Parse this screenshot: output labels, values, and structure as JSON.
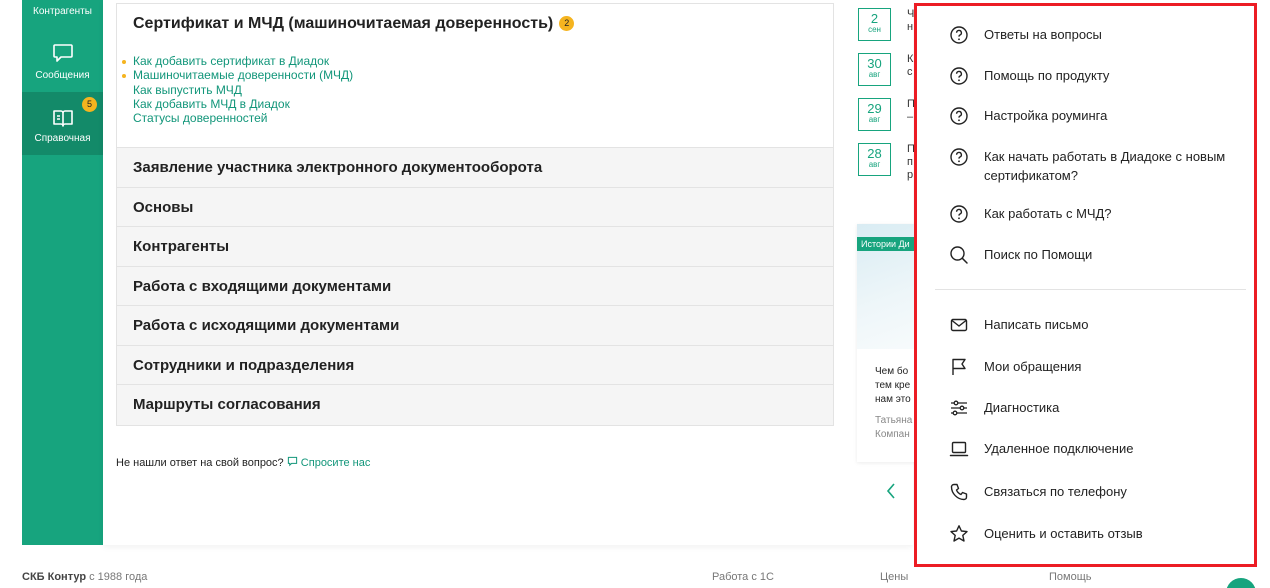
{
  "sidebar": {
    "items": [
      {
        "label": "Контрагенты",
        "icon": "contractors-icon"
      },
      {
        "label": "Сообщения",
        "icon": "chat-bubble-icon"
      },
      {
        "label": "Справочная",
        "icon": "book-icon",
        "badge": "5"
      }
    ]
  },
  "main": {
    "open_section": {
      "title": "Сертификат и МЧД (машиночитаемая доверенность)",
      "badge": "2",
      "links": [
        "Как добавить сертификат в Диадок",
        "Машиночитаемые доверенности (МЧД)",
        "Как выпустить МЧД",
        "Как добавить МЧД в Диадок",
        "Статусы доверенностей"
      ]
    },
    "sections": [
      "Заявление участника электронного документооборота",
      "Основы",
      "Контрагенты",
      "Работа с входящими документами",
      "Работа с исходящими документами",
      "Сотрудники и подразделения",
      "Маршруты согласования"
    ],
    "not_found_text": "Не нашли ответ на свой вопрос?",
    "ask_link": "Спросите нас"
  },
  "news": {
    "items": [
      {
        "day": "2",
        "month": "сен",
        "text": "Ч н"
      },
      {
        "day": "30",
        "month": "авг",
        "text": "К с"
      },
      {
        "day": "29",
        "month": "авг",
        "text": "П –"
      },
      {
        "day": "28",
        "month": "авг",
        "text": "П п р"
      }
    ],
    "story": {
      "tag": "Истории Ди",
      "title_lines": [
        "Чем бо",
        "тем кре",
        "нам это"
      ],
      "author_lines": [
        "Татьяна",
        "Компан"
      ]
    }
  },
  "help_menu": {
    "items": [
      {
        "label": "Ответы на вопросы",
        "icon": "question-circle-icon"
      },
      {
        "label": "Помощь по продукту",
        "icon": "question-circle-icon"
      },
      {
        "label": "Настройка роуминга",
        "icon": "question-circle-icon"
      },
      {
        "label": "Как начать работать в Диадоке с новым сертификатом?",
        "icon": "question-circle-icon"
      },
      {
        "label": "Как работать с МЧД?",
        "icon": "question-circle-icon"
      },
      {
        "label": "Поиск по Помощи",
        "icon": "search-icon"
      },
      {
        "label": "Написать письмо",
        "icon": "envelope-icon"
      },
      {
        "label": "Мои обращения",
        "icon": "flag-icon"
      },
      {
        "label": "Диагностика",
        "icon": "sliders-icon"
      },
      {
        "label": "Удаленное подключение",
        "icon": "laptop-icon"
      },
      {
        "label": "Связаться по телефону",
        "icon": "phone-icon"
      },
      {
        "label": "Оценить и оставить отзыв",
        "icon": "star-icon"
      }
    ]
  },
  "footer": {
    "brand": "СКБ Контур",
    "since": " с 1988 года",
    "links": [
      "Работа с 1С",
      "Цены",
      "Помощь"
    ]
  },
  "colors": {
    "accent": "#17a47e",
    "badge": "#f5b41f",
    "highlight_border": "#ec1c24"
  }
}
